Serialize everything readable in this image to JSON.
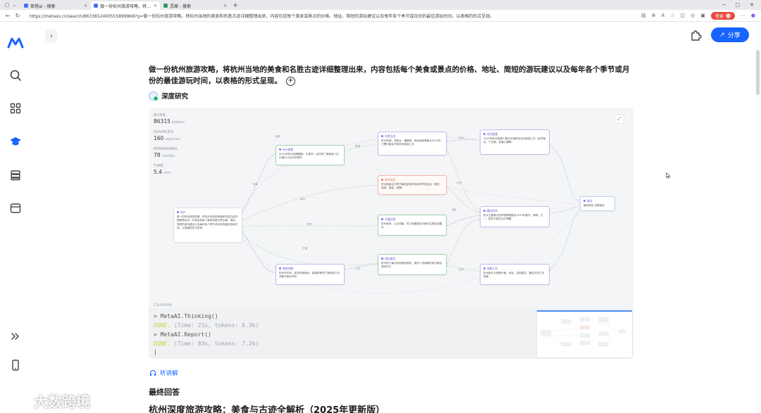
{
  "browser": {
    "tabs": [
      {
        "title": "密塔ai - 搜索",
        "active": false
      },
      {
        "title": "做一份杭州旅游攻略，将杭州当地",
        "active": true
      },
      {
        "title": "灵犀 - 搜索",
        "active": false
      }
    ],
    "url": "https://metaso.cn/search/8633652400555899968?q=做一份杭州旅游攻略，将杭州当地的美食和名胜古迹详细整理出来，内容包括每个美食或景点的价格、地址、简短的游玩建议以及每年各个季节或月份的最佳游玩时间，以表格的形式呈现。",
    "login_label": "登录"
  },
  "header": {
    "share_label": "分享"
  },
  "question": "做一份杭州旅游攻略，将杭州当地的美食和名胜古迹详细整理出来，内容包括每个美食或景点的价格、地址、简短的游玩建议以及每年各个季节或月份的最佳游玩时间，以表格的形式呈现。",
  "deep_research_label": "深度研究",
  "stats": [
    {
      "label": "BURN",
      "value": "86315",
      "unit": "tokens"
    },
    {
      "label": "SOURCES",
      "value": "160",
      "unit": "sources"
    },
    {
      "label": "REMAINING",
      "value": "78",
      "unit": "credits"
    },
    {
      "label": "TIME",
      "value": "5.4",
      "unit": "min"
    }
  ],
  "flow_nodes": [
    {
      "title": "用户",
      "text": "做一份杭州旅游攻略，将杭州当地的美食和名胜古迹详细整理出来，内容包括每个美食或景点的价格、地址、简短的游玩建议以及每年各个季节或月份的最佳游玩时间，以表格的形式呈现。"
    },
    {
      "title": "杭州美食",
      "text": "2024年杭州西湖醋鱼、东坡肉、龙井虾仁等美食人均价格与门店分布情况"
    },
    {
      "title": "名胜古迹",
      "text": "杭州西湖、灵隐寺、雷峰塔、西溪湿地等景点2025年门票价格及开放时间信息汇总"
    },
    {
      "title": "季节玩法",
      "text": "杭州各景点分季节最佳游览时间及季节性活动（赏花、赏荷、赏桂、观雪）"
    },
    {
      "title": "交通住宿",
      "text": "杭州地铁、公交线路、热门商圈酒店价格与住宿区域建议"
    },
    {
      "title": "游玩建议",
      "text": "杭州热门景点游玩路线规划、避开人流高峰时段与建议游玩时长"
    },
    {
      "title": "综合整理",
      "text": "2025年杭州西湖十景分月推荐及活动信息汇总（如灵隐寺、千岛湖、钱塘江潮等）"
    },
    {
      "title": "最佳时间",
      "text": "杭州主要景点四季推荐指数及2025年春节、清明、五一、国庆节假日出行提醒"
    },
    {
      "title": "美食攻略",
      "text": "杭州河坊街、胜利河美食街、高银街等热门美食街人均消费与营业时间"
    },
    {
      "title": "表格汇总",
      "text": "杭州景点与美食价格、地址、游玩建议、最佳月份汇总表格"
    },
    {
      "title": "报告",
      "text": "最终报告 查看报告"
    }
  ],
  "edge_labels": [
    "美食",
    "景点",
    "季节",
    "交通",
    "路线",
    "整理",
    "汇总",
    "时间",
    "补充",
    "验证",
    "生成"
  ],
  "console": {
    "label": "Console",
    "lines": [
      {
        "prompt": "> MetaAI.Thinking()",
        "done": "",
        "meta": ""
      },
      {
        "prompt": "",
        "done": "DONE.",
        "meta": " (Time: 21s, tokens: 6.3k)"
      },
      {
        "prompt": "> MetaAI.Report()",
        "done": "",
        "meta": ""
      },
      {
        "prompt": "",
        "done": "DONE.",
        "meta": " (Time: 83s, tokens: 7.2k)"
      },
      {
        "prompt": "|",
        "done": "",
        "meta": ""
      }
    ]
  },
  "listen_label": "听讲解",
  "final_answer_label": "最终回答",
  "answer_title": "杭州深度旅游攻略：美食与古迹全解析（2025年更新版）",
  "watermark_text": "大数跨境",
  "colors": {
    "accent": "#1764ff",
    "login": "#e64b3c",
    "console_done": "#c9d13a"
  }
}
